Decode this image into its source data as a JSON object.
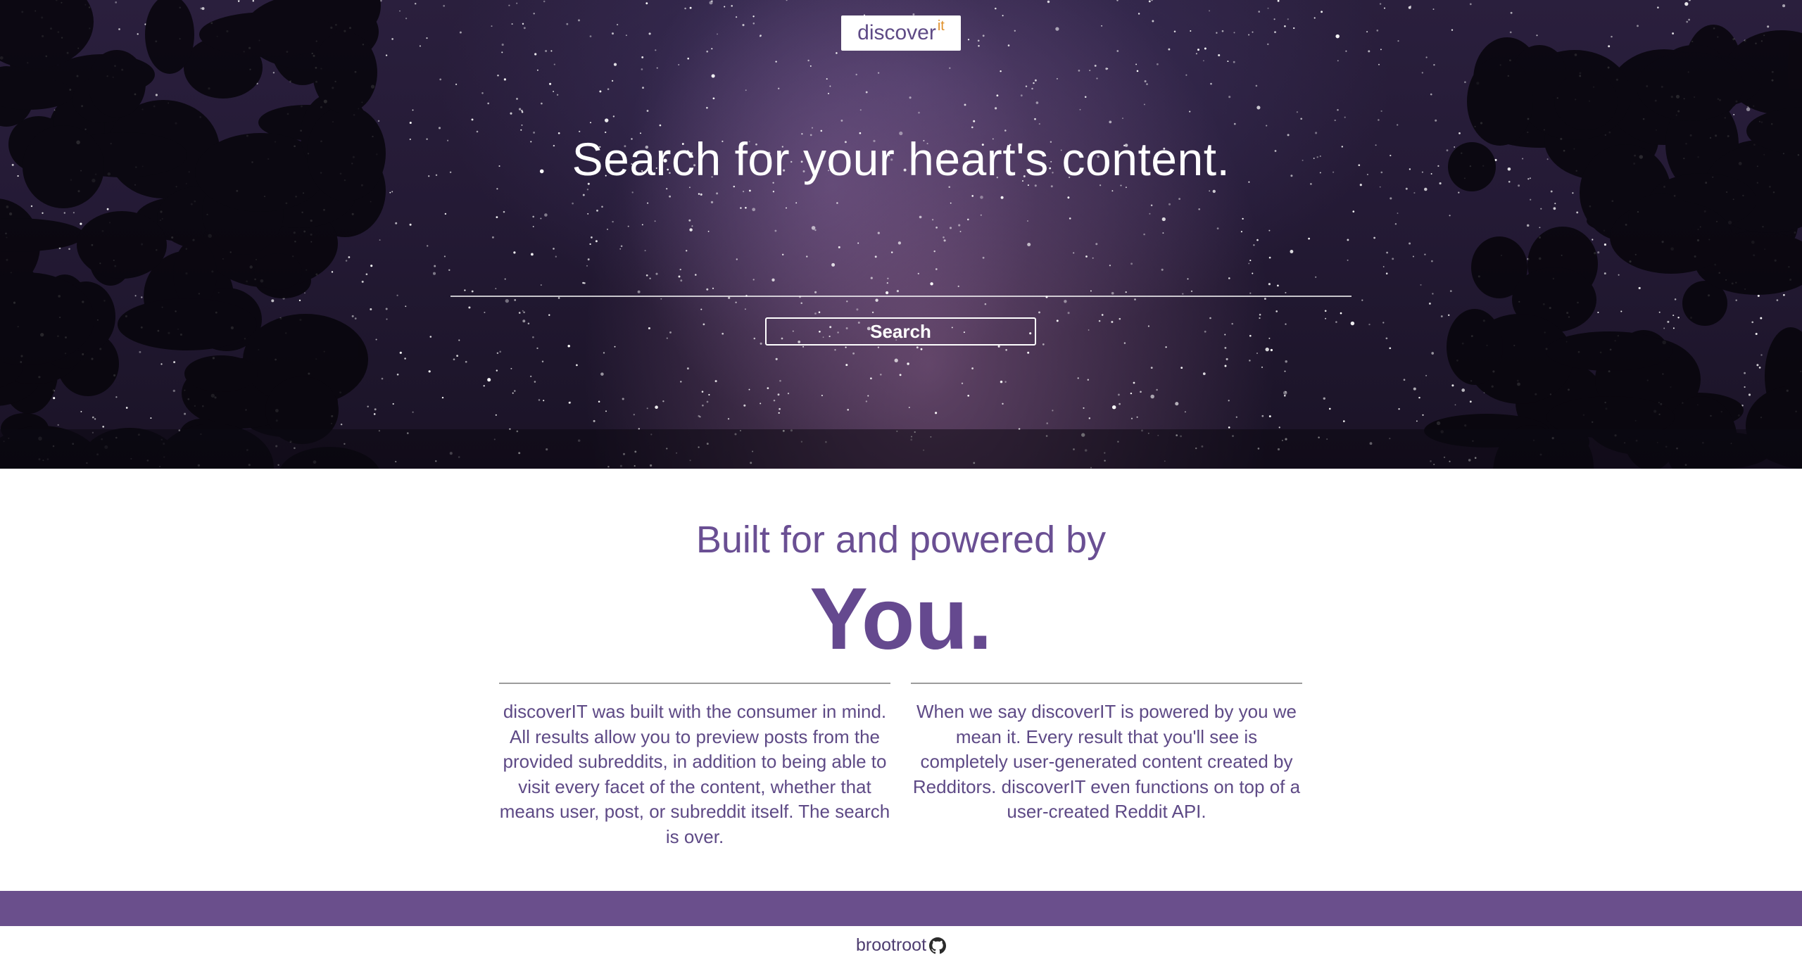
{
  "header": {
    "brand_main": "discover",
    "brand_super": "it"
  },
  "hero": {
    "title": "Search for your heart's content.",
    "search_placeholder": "",
    "search_value": "",
    "search_button_label": "Search"
  },
  "about": {
    "heading": "Built for and powered by",
    "emphasis": "You.",
    "left_text": "discoverIT was built with the consumer in mind. All results allow you to preview posts from the provided subreddits, in addition to being able to visit every facet of the content, whether that means user, post, or subreddit itself. The search is over.",
    "right_text": "When we say discoverIT is powered by you we mean it. Every result that you'll see is completely user-generated content created by Redditors. discoverIT even functions on top of a user-created Reddit API."
  },
  "footer": {
    "author_link": "brootroot",
    "icon": "github-icon"
  },
  "colors": {
    "accent_purple": "#6a4f8c",
    "brand_orange": "#e0902a",
    "text_purple": "#5e4a86"
  }
}
